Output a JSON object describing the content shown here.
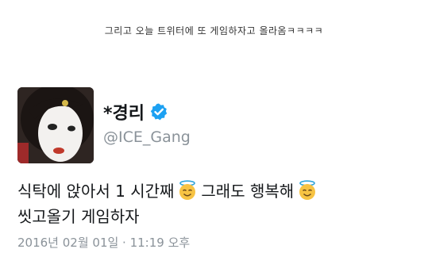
{
  "caption": "그리고 오늘 트위터에 또 게임하자고 올라옴ㅋㅋㅋㅋ",
  "tweet": {
    "display_name": "*경리",
    "handle": "@ICE_Gang",
    "text_part1": "식탁에 앉아서 1 시간째",
    "text_part2": "그래도 행복해",
    "text_line2": "씻고올기 게임하자",
    "timestamp": "2016년 02월 01일 · 11:19 오후",
    "icons": {
      "verified": "verified-badge-icon",
      "emoji": "smiling-face-with-halo-icon"
    },
    "colors": {
      "verified": "#1da1f2",
      "handle": "#8a9299",
      "text": "#14171a"
    }
  }
}
